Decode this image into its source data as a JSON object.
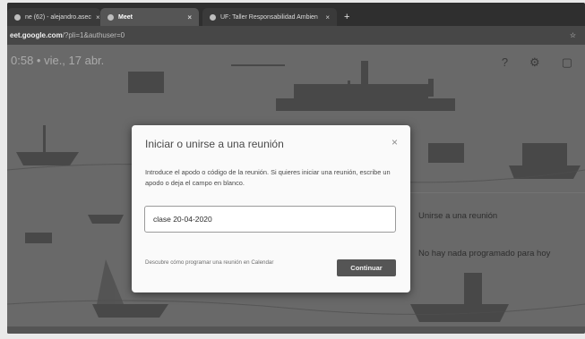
{
  "browser": {
    "tabs": [
      {
        "label": "ne (62) - alejandro.asec"
      },
      {
        "label": "Meet"
      },
      {
        "label": "UF: Taller Responsabilidad Ambien"
      }
    ],
    "url_domain": "eet.google.com",
    "url_path": "/?pli=1&authuser=0"
  },
  "meet": {
    "clock": "0:58  •  vie., 17 abr.",
    "side_items": [
      "Unirse a una reunión",
      "No hay nada programado para hoy"
    ]
  },
  "dialog": {
    "title": "Iniciar o unirse a una reunión",
    "close": "×",
    "description": "Introduce el apodo o código de la reunión. Si quieres iniciar una reunión, escribe un apodo o deja el campo en blanco.",
    "input_value": "clase 20-04-2020",
    "help": "Descubre cómo programar una reunión en Calendar",
    "continue_label": "Continuar"
  },
  "icons": [
    "close-icon",
    "new-tab-icon",
    "help-icon",
    "settings-icon",
    "feedback-icon",
    "star-icon"
  ],
  "colors": {
    "dialog_bg": "#fafafa",
    "button_bg": "#555555",
    "page_bg": "#7b7b7b"
  }
}
